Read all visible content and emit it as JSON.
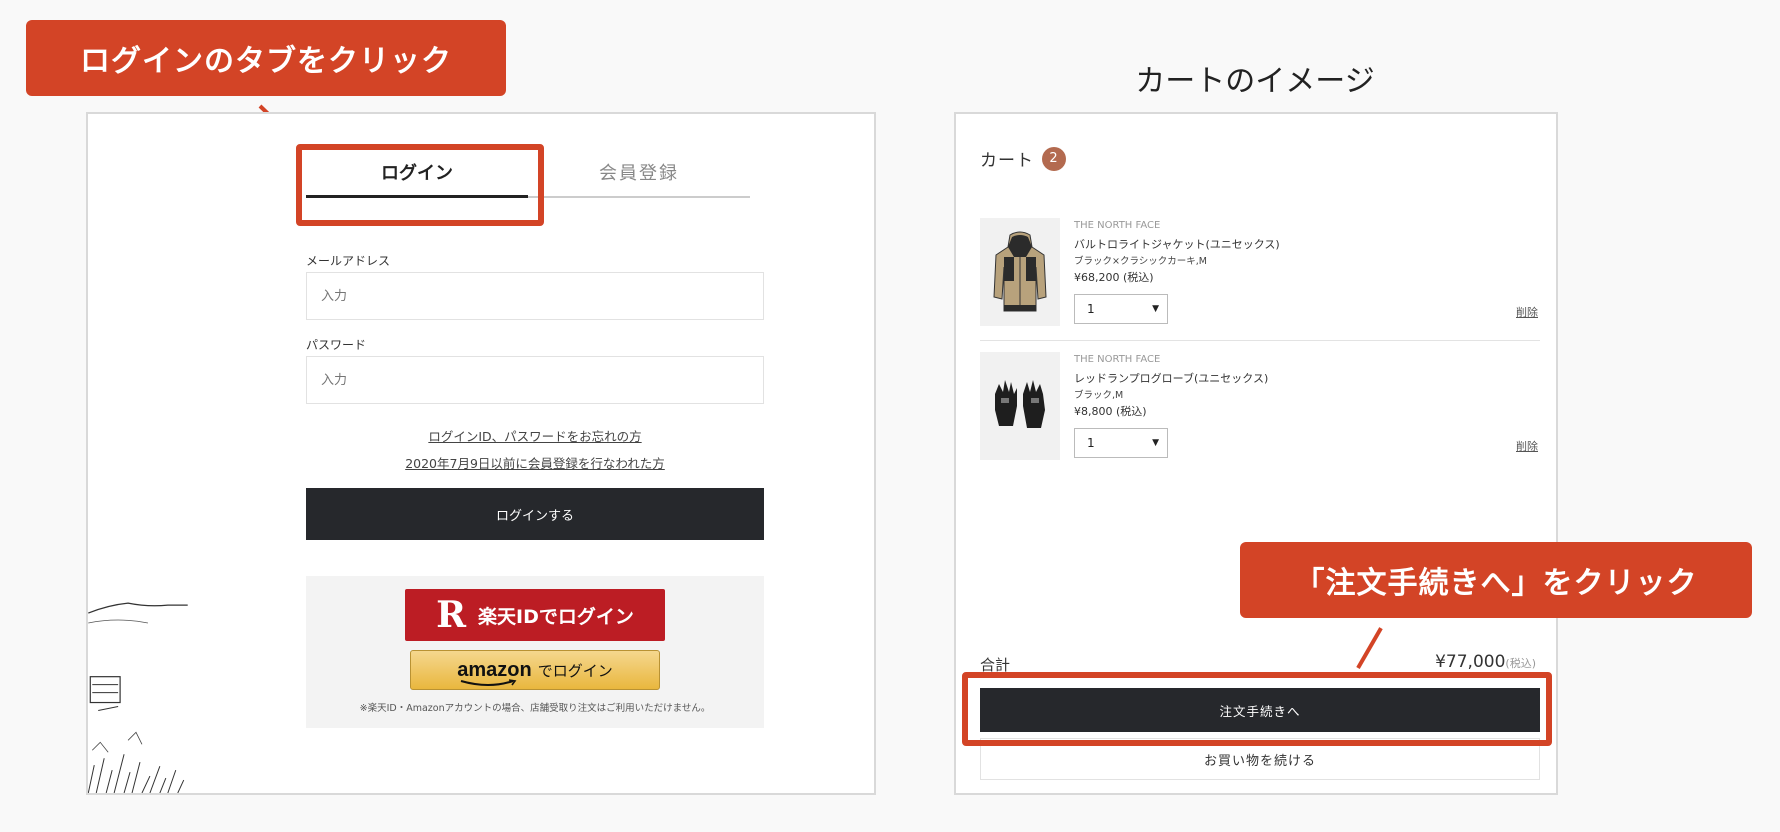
{
  "callouts": {
    "login_tab": "ログインのタブをクリック",
    "checkout": "「注文手続きへ」をクリック"
  },
  "login": {
    "tabs": [
      {
        "label": "ログイン",
        "active": true
      },
      {
        "label": "会員登録",
        "active": false
      }
    ],
    "email_label": "メールアドレス",
    "email_placeholder": "入力",
    "password_label": "パスワード",
    "password_placeholder": "入力",
    "forgot_link": "ログインID、パスワードをお忘れの方",
    "legacy_link": "2020年7月9日以前に会員登録を行なわれた方",
    "submit_label": "ログインする",
    "rakuten_logo": "R",
    "rakuten_label": "楽天IDでログイン",
    "amazon_logo": "amazon",
    "amazon_label": "でログイン",
    "social_note": "※楽天ID・Amazonアカウントの場合、店舗受取り注文はご利用いただけません。"
  },
  "cart": {
    "heading": "カートのイメージ",
    "title": "カート",
    "count": "2",
    "items": [
      {
        "brand": "THE NORTH FACE",
        "name": "バルトロライトジャケット(ユニセックス)",
        "variant": "ブラック×クラシックカーキ,M",
        "price": "¥68,200 (税込)",
        "quantity": "1",
        "delete_label": "削除"
      },
      {
        "brand": "THE NORTH FACE",
        "name": "レッドランプログローブ(ユニセックス)",
        "variant": "ブラック,M",
        "price": "¥8,800 (税込)",
        "quantity": "1",
        "delete_label": "削除"
      }
    ],
    "total_label": "合計",
    "total_value": "¥77,000",
    "total_tax": "(税込)",
    "checkout_label": "注文手続きへ",
    "continue_label": "お買い物を続ける"
  },
  "colors": {
    "accent": "#d34426",
    "button_dark": "#26282c",
    "rakuten": "#bc1d24",
    "badge": "#b36a4f"
  }
}
